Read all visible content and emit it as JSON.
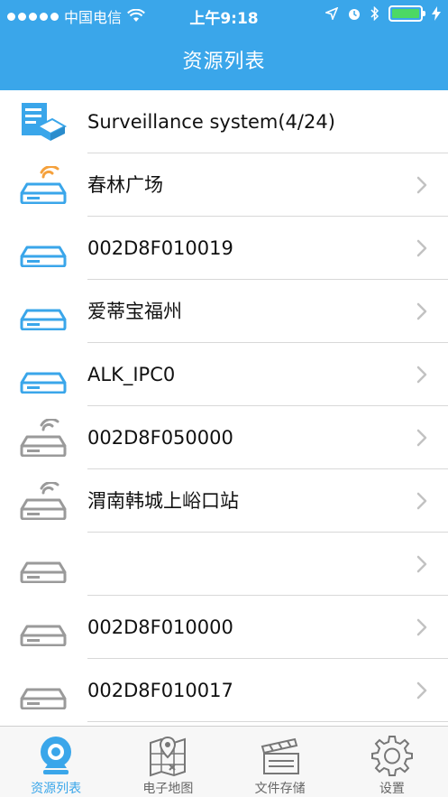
{
  "status_bar": {
    "carrier": "中国电信",
    "time": "上午9:18"
  },
  "nav": {
    "title": "资源列表"
  },
  "colors": {
    "accent": "#3aa6ea",
    "online": "#3aa6ea",
    "offline": "#9a9a9a",
    "signal": "#f5a13c",
    "battery": "#4cd964"
  },
  "list": {
    "group": {
      "label": "Surveillance system(4/24)",
      "icon": "server-group-icon"
    },
    "items": [
      {
        "label": "春林广场",
        "status": "online",
        "signal": true
      },
      {
        "label": "002D8F010019",
        "status": "online",
        "signal": false
      },
      {
        "label": "爱蒂宝福州",
        "status": "online",
        "signal": false
      },
      {
        "label": "ALK_IPC0",
        "status": "online",
        "signal": false
      },
      {
        "label": "002D8F050000",
        "status": "offline",
        "signal": true
      },
      {
        "label": "渭南韩城上峪口站",
        "status": "offline",
        "signal": true
      },
      {
        "label": "",
        "status": "offline",
        "signal": false
      },
      {
        "label": "002D8F010000",
        "status": "offline",
        "signal": false
      },
      {
        "label": "002D8F010017",
        "status": "offline",
        "signal": false
      }
    ]
  },
  "tabbar": {
    "tabs": [
      {
        "label": "资源列表",
        "icon": "camera-icon",
        "active": true
      },
      {
        "label": "电子地图",
        "icon": "map-icon",
        "active": false
      },
      {
        "label": "文件存储",
        "icon": "clapperboard-icon",
        "active": false
      },
      {
        "label": "设置",
        "icon": "gear-icon",
        "active": false
      }
    ]
  }
}
